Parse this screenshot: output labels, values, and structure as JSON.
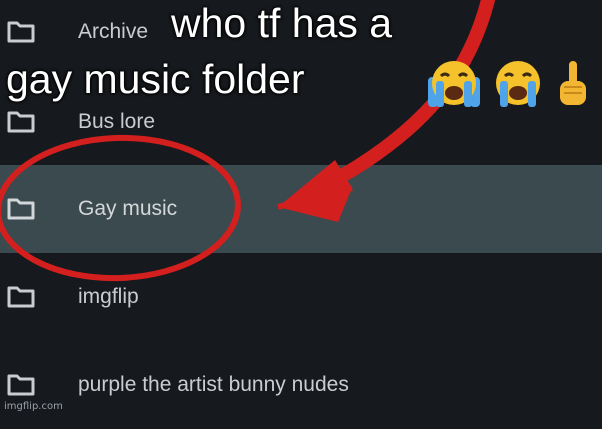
{
  "folders": [
    {
      "label": "Archive",
      "icon": "folder-icon",
      "selected": false
    },
    {
      "label": "Bus lore",
      "icon": "folder-icon",
      "selected": false
    },
    {
      "label": "Gay music",
      "icon": "folder-icon",
      "selected": true
    },
    {
      "label": "imgflip",
      "icon": "folder-icon",
      "selected": false
    },
    {
      "label": "purple the artist bunny nudes",
      "icon": "folder-icon",
      "selected": false
    }
  ],
  "caption": {
    "line1": "who tf has a",
    "line2": "gay music folder"
  },
  "emojis": [
    "loudly-crying-face-icon",
    "loudly-crying-face-icon",
    "pointing-up-hand-icon"
  ],
  "watermark": "imgflip.com",
  "colors": {
    "background": "#16191d",
    "selected_row": "#3a4a4f",
    "annotation_red": "#d41f1f"
  }
}
